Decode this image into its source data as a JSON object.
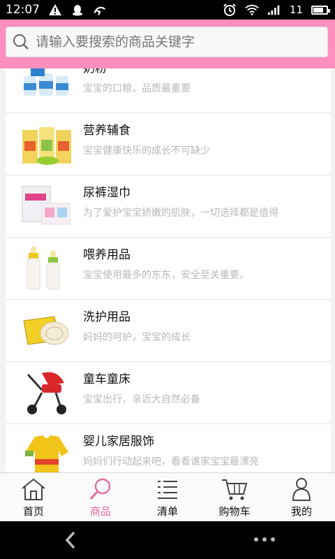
{
  "status_bar": {
    "time": "12:07",
    "signal_text": "11"
  },
  "search": {
    "placeholder": "请输入要搜索的商品关键字"
  },
  "categories": [
    {
      "title": "奶粉",
      "subtitle": "宝宝的口粮，品质最重要",
      "icon": "milk-powder-cans"
    },
    {
      "title": "营养辅食",
      "subtitle": "宝宝健康快乐的成长不可缺少",
      "icon": "baby-food-boxes"
    },
    {
      "title": "尿裤湿巾",
      "subtitle": "为了爱护宝宝娇嫩的肌肤，一切选择都是值得",
      "icon": "diaper-pack"
    },
    {
      "title": "喂养用品",
      "subtitle": "宝宝使用最多的东东，安全至关重要。",
      "icon": "baby-bottles"
    },
    {
      "title": "洗护用品",
      "subtitle": "妈妈的呵护，宝宝的成长",
      "icon": "soap-box"
    },
    {
      "title": "童车童床",
      "subtitle": "宝宝出行，亲近大自然必备",
      "icon": "stroller"
    },
    {
      "title": "婴儿家居服饰",
      "subtitle": "妈妈们行动起来吧，看看谁家宝宝最漂亮",
      "icon": "baby-clothes"
    }
  ],
  "tabs": [
    {
      "label": "首页",
      "icon": "home-icon",
      "active": false
    },
    {
      "label": "商品",
      "icon": "search-icon",
      "active": true
    },
    {
      "label": "清单",
      "icon": "list-icon",
      "active": false
    },
    {
      "label": "购物车",
      "icon": "cart-icon",
      "active": false
    },
    {
      "label": "我的",
      "icon": "user-icon",
      "active": false
    }
  ],
  "colors": {
    "search_bar_bg": "#ff8fbe",
    "active_tab": "#e76aa0",
    "subtitle_gray": "#b8b8b8"
  }
}
